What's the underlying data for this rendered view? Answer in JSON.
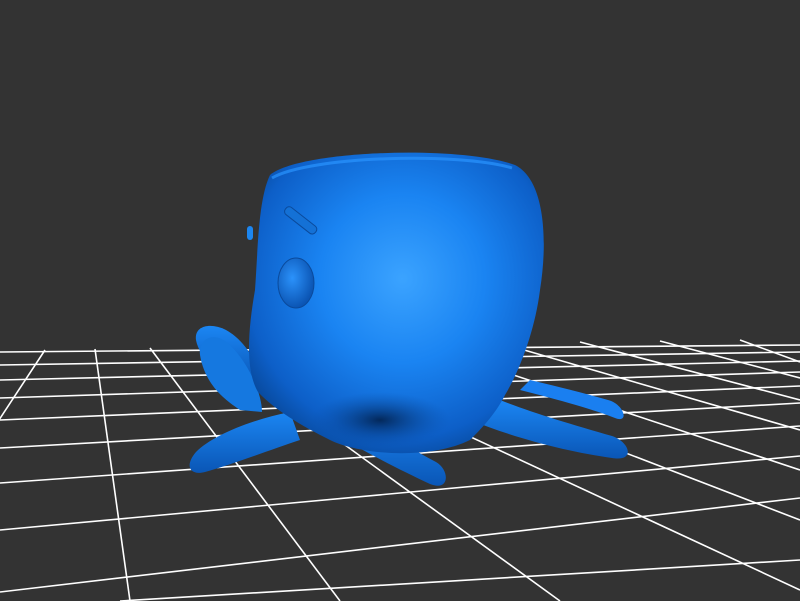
{
  "viewer": {
    "background_color": "#333333",
    "grid_color": "#ffffff",
    "model_color": "#1a7ff0",
    "model_highlight_color": "#3aa0ff",
    "model_shadow_color": "#063a80"
  }
}
